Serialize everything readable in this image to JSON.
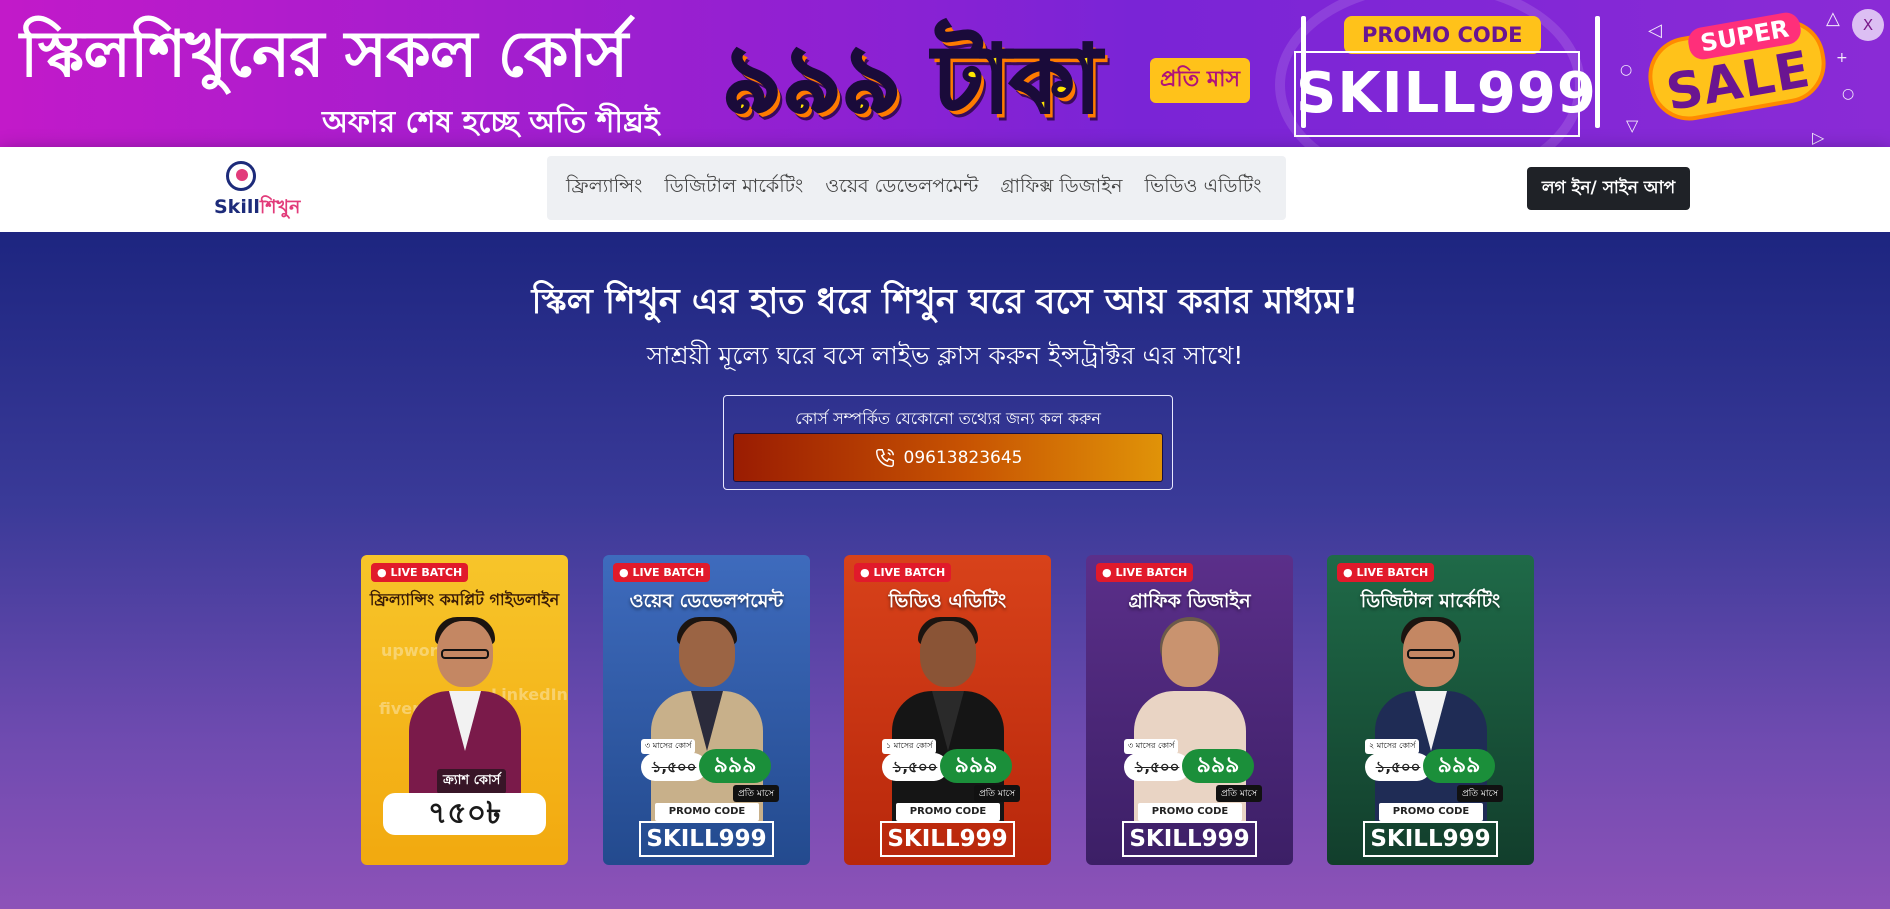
{
  "banner": {
    "title": "স্কিলশিখুনের সকল কোর্স",
    "subtitle": "অফার শেষ হচ্ছে অতি শীঘ্রই",
    "price": "৯৯৯ টাকা",
    "per_month": "প্রতি মাস",
    "promo_label": "PROMO CODE",
    "promo_code": "SKILL999",
    "sale_super": "SUPER",
    "sale_sale": "SALE",
    "close_label": "X"
  },
  "header": {
    "logo_main": "Skill",
    "logo_accent": "শিখুন",
    "nav": [
      "ফ্রিল্যান্সিং",
      "ডিজিটাল মার্কেটিং",
      "ওয়েব ডেভেলপমেন্ট",
      "গ্রাফিক্স ডিজাইন",
      "ভিডিও এডিটিং"
    ],
    "login_label": "লগ ইন/ সাইন আপ"
  },
  "hero": {
    "title": "স্কিল শিখুন এর হাত ধরে শিখুন ঘরে বসে আয় করার মাধ্যম!",
    "subtitle": "সাশ্রয়ী মূল্যে ঘরে বসে লাইভ ক্লাস করুন ইন্সট্রাক্টর এর সাথে!",
    "call_label": "কোর্স সম্পর্কিত যেকোনো তথ্যের জন্য কল করুন",
    "phone": "09613823645"
  },
  "cards": [
    {
      "live": "LIVE BATCH",
      "title": "ফ্রিল্যান্সিং কমপ্লিট গাইডলাইন",
      "crash_label": "ক্র্যাশ কোর্স",
      "crash_price": "৭৫০৳",
      "brands": [
        "upwork",
        "fiverr",
        "LinkedIn"
      ],
      "bg": "#f5b814"
    },
    {
      "live": "LIVE BATCH",
      "title": "ওয়েব ডেভেলপমেন্ট",
      "duration": "৩ মাসের কোর্স",
      "old_price": "১,৫০০",
      "new_price": "৯৯৯",
      "per_month": "প্রতি মাসে",
      "promo_label": "PROMO CODE",
      "promo_code": "SKILL999",
      "bg": "#2d4f9a"
    },
    {
      "live": "LIVE BATCH",
      "title": "ভিডিও এডিটিং",
      "duration": "১ মাসের কোর্স",
      "old_price": "১,৫০০",
      "new_price": "৯৯৯",
      "per_month": "প্রতি মাসে",
      "promo_label": "PROMO CODE",
      "promo_code": "SKILL999",
      "bg": "#c8360e"
    },
    {
      "live": "LIVE BATCH",
      "title": "গ্রাফিক ডিজাইন",
      "duration": "৩ মাসের কোর্স",
      "old_price": "১,৫০০",
      "new_price": "৯৯৯",
      "per_month": "প্রতি মাসে",
      "promo_label": "PROMO CODE",
      "promo_code": "SKILL999",
      "bg": "#4b2a78"
    },
    {
      "live": "LIVE BATCH",
      "title": "ডিজিটাল মার্কেটিং",
      "duration": "২ মাসের কোর্স",
      "old_price": "১,৫০০",
      "new_price": "৯৯৯",
      "per_month": "প্রতি মাসে",
      "promo_label": "PROMO CODE",
      "promo_code": "SKILL999",
      "bg": "#17553a"
    }
  ]
}
